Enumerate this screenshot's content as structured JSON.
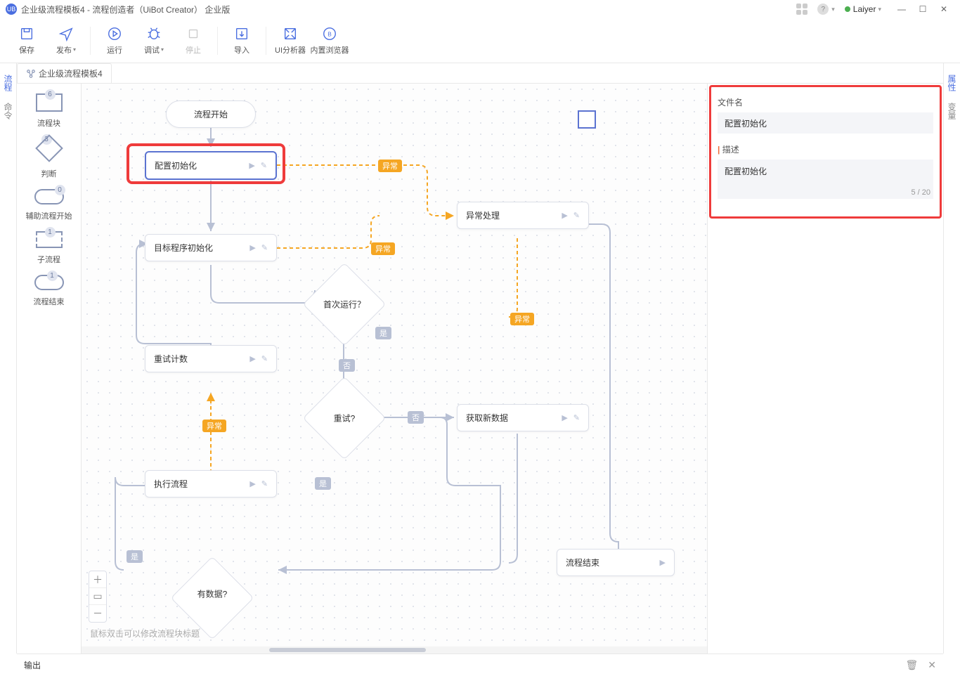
{
  "titlebar": {
    "app_title": "企业级流程模板4 - 流程创造者（UiBot Creator）  企业版",
    "user_name": "Laiyer"
  },
  "toolbar": {
    "save": "保存",
    "publish": "发布",
    "run": "运行",
    "debug": "调试",
    "stop": "停止",
    "import": "导入",
    "ui_analyzer": "UI分析器",
    "builtin_browser": "内置浏览器"
  },
  "left_rail": {
    "tab1": "流程",
    "tab2": "命令"
  },
  "right_rail": {
    "tab1": "属性",
    "tab2": "变量"
  },
  "doc_tab": "企业级流程模板4",
  "palette": {
    "items": [
      {
        "label": "流程块",
        "badge": "6"
      },
      {
        "label": "判断",
        "badge": "3"
      },
      {
        "label": "辅助流程开始",
        "badge": "0"
      },
      {
        "label": "子流程",
        "badge": "1"
      },
      {
        "label": "流程结束",
        "badge": "1"
      }
    ]
  },
  "nodes": {
    "start": "流程开始",
    "config_init": "配置初始化",
    "target_init": "目标程序初始化",
    "first_run": "首次运行？",
    "retry_count": "重试计数",
    "retry": "重试?",
    "exec_flow": "执行流程",
    "exception": "异常处理",
    "get_data": "获取新数据",
    "has_data": "有数据?",
    "flow_end": "流程结束"
  },
  "edge_labels": {
    "exception": "异常",
    "yes": "是",
    "no": "否"
  },
  "canvas": {
    "hint": "鼠标双击可以修改流程块标题"
  },
  "props": {
    "filename_label": "文件名",
    "filename_value": "配置初始化",
    "desc_label": "描述",
    "desc_value": "配置初始化",
    "char_count": "5 / 20"
  },
  "output_bar": {
    "label": "输出"
  }
}
